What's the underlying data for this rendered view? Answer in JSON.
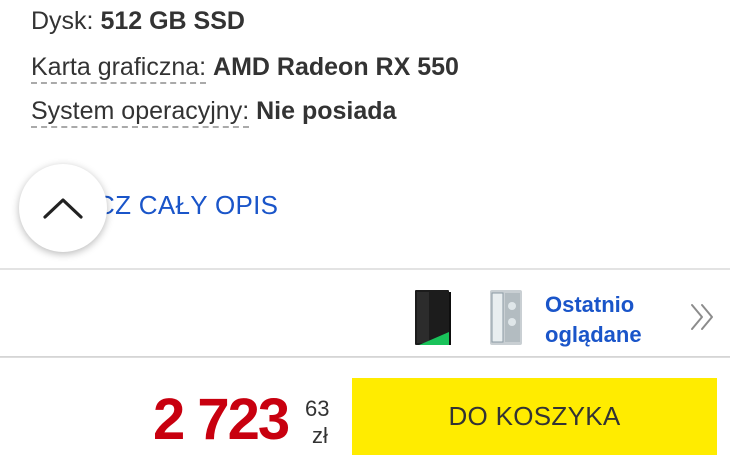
{
  "specs": [
    {
      "key": "Dysk:",
      "value": "512 GB SSD"
    },
    {
      "key": "Karta graficzna:",
      "value": "AMD Radeon RX 550"
    },
    {
      "key": "System operacyjny:",
      "value": "Nie posiada"
    }
  ],
  "description": {
    "read_more_label": "CZ CAŁY OPIS",
    "collapse_icon": "chevron-up-icon"
  },
  "recently_viewed": {
    "label": "Ostatnio\noglądane",
    "items": [
      {
        "icon": "pc-tower-black-green-icon",
        "colors": {
          "body": "#1c1c1c",
          "accent": "#19c35a"
        }
      },
      {
        "icon": "pc-tower-silver-glass-icon",
        "colors": {
          "body": "#c9cfd3",
          "accent": "#8a9aa3"
        }
      }
    ],
    "arrow_icon": "double-chevron-right-icon"
  },
  "price": {
    "integer": "2 723",
    "decimal": "63",
    "currency": "zł",
    "color": "#c8000f"
  },
  "cart": {
    "button_label": "DO KOSZYKA",
    "color": "#ffec00"
  },
  "colors": {
    "link": "#1a55c9",
    "text": "#333333"
  }
}
